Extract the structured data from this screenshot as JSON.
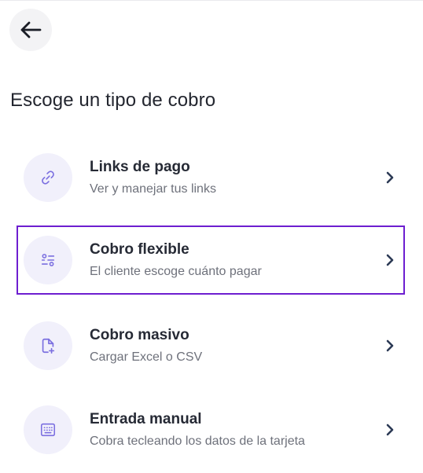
{
  "header": {
    "back_icon": "arrow-left-icon"
  },
  "page": {
    "title": "Escoge un tipo de cobro"
  },
  "options": [
    {
      "title": "Links de pago",
      "subtitle": "Ver y manejar tus links",
      "icon": "link-icon",
      "selected": false
    },
    {
      "title": "Cobro flexible",
      "subtitle": "El cliente escoge cuánto pagar",
      "icon": "sliders-icon",
      "selected": true
    },
    {
      "title": "Cobro masivo",
      "subtitle": "Cargar Excel o CSV",
      "icon": "file-add-icon",
      "selected": false
    },
    {
      "title": "Entrada manual",
      "subtitle": "Cobra tecleando los datos de la tarjeta",
      "icon": "keyboard-icon",
      "selected": false
    }
  ],
  "colors": {
    "accent": "#6d1ed0",
    "icon_bg": "#f1f0fb",
    "icon_stroke": "#7b6fe0",
    "chevron": "#2c3a55"
  }
}
